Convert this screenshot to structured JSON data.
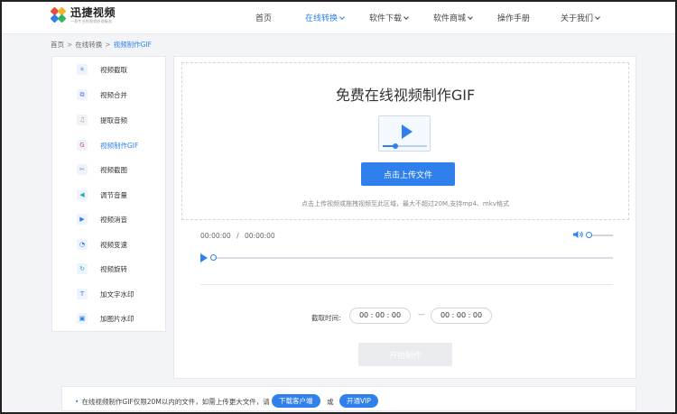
{
  "header": {
    "logo_name": "迅捷视频",
    "logo_slogan": "一款专业的视频处理服务",
    "nav": [
      {
        "label": "首页",
        "active": false,
        "dropdown": false
      },
      {
        "label": "在线转换",
        "active": true,
        "dropdown": true
      },
      {
        "label": "软件下载",
        "active": false,
        "dropdown": true
      },
      {
        "label": "软件商城",
        "active": false,
        "dropdown": true
      },
      {
        "label": "操作手册",
        "active": false,
        "dropdown": false
      },
      {
        "label": "关于我们",
        "active": false,
        "dropdown": true
      }
    ]
  },
  "breadcrumb": {
    "home": "首页",
    "section": "在线转换",
    "current": "视频制作GIF",
    "separator": ">"
  },
  "sidebar": {
    "items": [
      {
        "label": "视频截取",
        "icon": "crop-icon",
        "glyph": "⌗",
        "color": "#2f80ed"
      },
      {
        "label": "视频合并",
        "icon": "merge-icon",
        "glyph": "⧉",
        "color": "#5b6ee8"
      },
      {
        "label": "提取音频",
        "icon": "headphones-icon",
        "glyph": "♫",
        "color": "#f08a2c"
      },
      {
        "label": "视频制作GIF",
        "icon": "gif-icon",
        "glyph": "G",
        "color": "#e94b3c",
        "active": true
      },
      {
        "label": "视频截图",
        "icon": "scissors-icon",
        "glyph": "✂",
        "color": "#7a8aa8"
      },
      {
        "label": "调节音量",
        "icon": "volume-icon",
        "glyph": "◀",
        "color": "#19b6a3"
      },
      {
        "label": "视频消音",
        "icon": "mute-icon",
        "glyph": "▶",
        "color": "#2f80ed"
      },
      {
        "label": "视频变速",
        "icon": "speed-icon",
        "glyph": "◔",
        "color": "#2f80ed"
      },
      {
        "label": "视频旋转",
        "icon": "rotate-icon",
        "glyph": "↻",
        "color": "#19b6a3"
      },
      {
        "label": "加文字水印",
        "icon": "text-watermark-icon",
        "glyph": "T",
        "color": "#2f80ed"
      },
      {
        "label": "加图片水印",
        "icon": "image-watermark-icon",
        "glyph": "▣",
        "color": "#2f80ed"
      }
    ]
  },
  "main": {
    "title": "免费在线视频制作GIF",
    "upload_button": "点击上传文件",
    "upload_hint": "点击上传视频或拖拽视频至此区域，最大不超过20M,支持mp4、mkv格式",
    "player": {
      "current_time": "00:00:00",
      "separator": "/",
      "total_time": "00:00:00",
      "progress": 0,
      "volume": 0
    },
    "clip": {
      "label": "截取时间:",
      "start": "00 : 00 : 00",
      "dash": "—",
      "end": "00 : 00 : 00"
    },
    "make_button": "开始制作"
  },
  "notice": {
    "text": "在线视频制作GIF仅限20M以内的文件，如需上传更大文件，请",
    "download_button": "下载客户端",
    "or": "或",
    "vip_button": "开通VIP"
  },
  "colors": {
    "accent": "#2f80ed",
    "disabled": "#e9ebee",
    "background": "#f2f4f7"
  }
}
